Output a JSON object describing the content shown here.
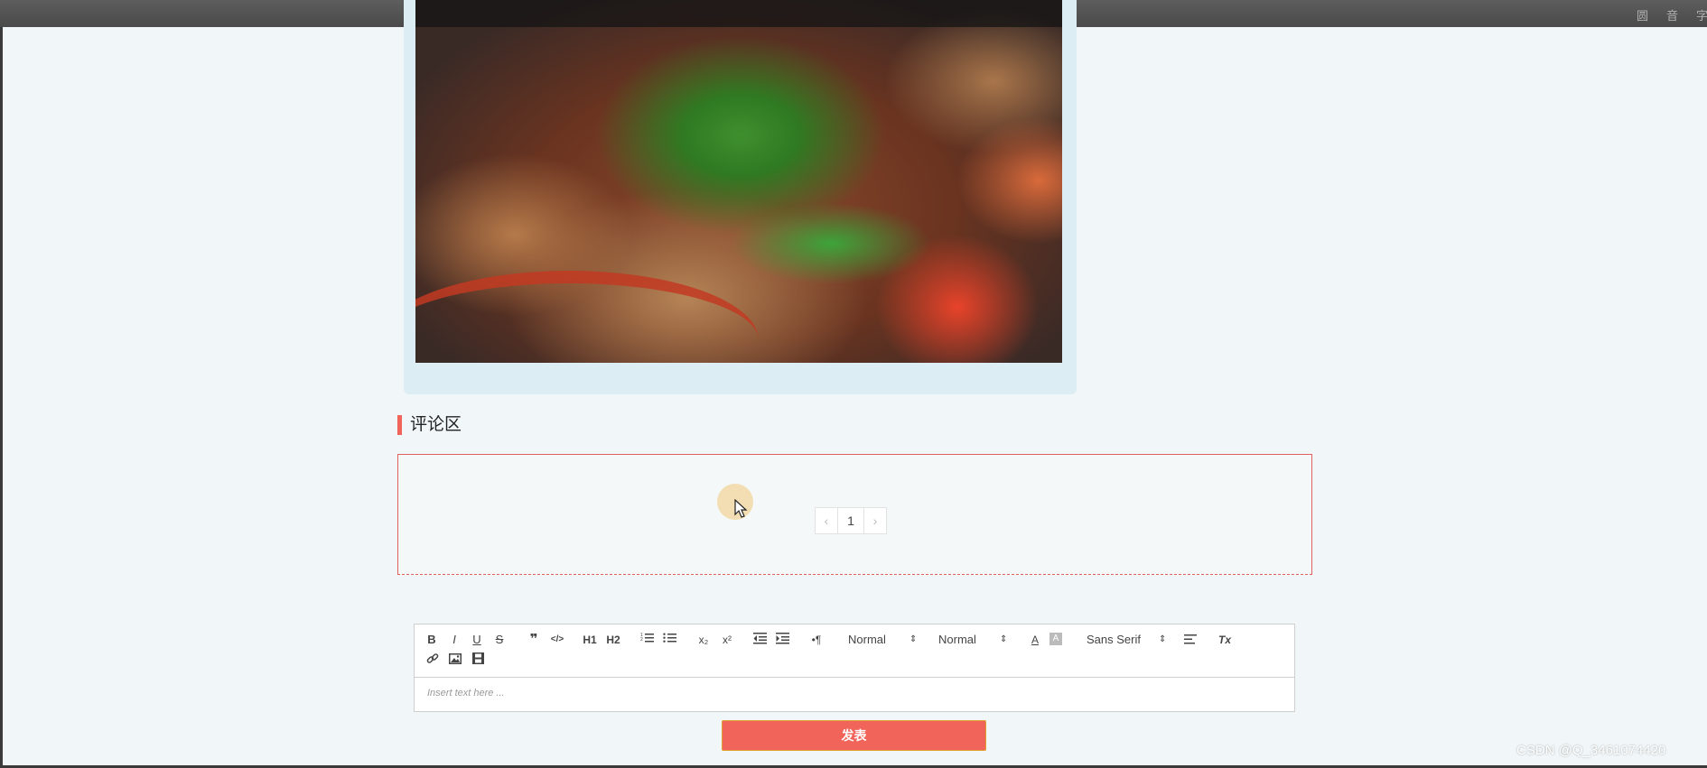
{
  "top_bar": {
    "items": [
      "圆",
      "音",
      "字"
    ]
  },
  "image": {
    "icon": "food-photo-image"
  },
  "comments": {
    "section_title": "评论区",
    "pager": {
      "prev": "‹",
      "current": "1",
      "next": "›"
    }
  },
  "editor": {
    "toolbar": {
      "bold": "B",
      "italic": "I",
      "underline": "U",
      "strike": "S",
      "blockquote": "❞",
      "code": "</>",
      "h1": "H1",
      "h2": "H2",
      "ordered_list": "ordered-list-icon",
      "bullet_list": "bullet-list-icon",
      "subscript": "x₂",
      "superscript": "x²",
      "outdent": "outdent-icon",
      "indent": "indent-icon",
      "rtl": "•¶",
      "size_picker": "Normal",
      "header_picker": "Normal",
      "color": "A",
      "background": "A",
      "font_picker": "Sans Serif",
      "align": "align-icon",
      "clean": "Tx",
      "link": "link-icon",
      "image": "image-icon",
      "video": "video-icon"
    },
    "placeholder": "Insert text here ..."
  },
  "submit_label": "发表",
  "watermark": "CSDN @Q_3461074420",
  "colors": {
    "accent": "#f0645a",
    "background": "#f1f7f8",
    "card": "#dcedf4"
  }
}
